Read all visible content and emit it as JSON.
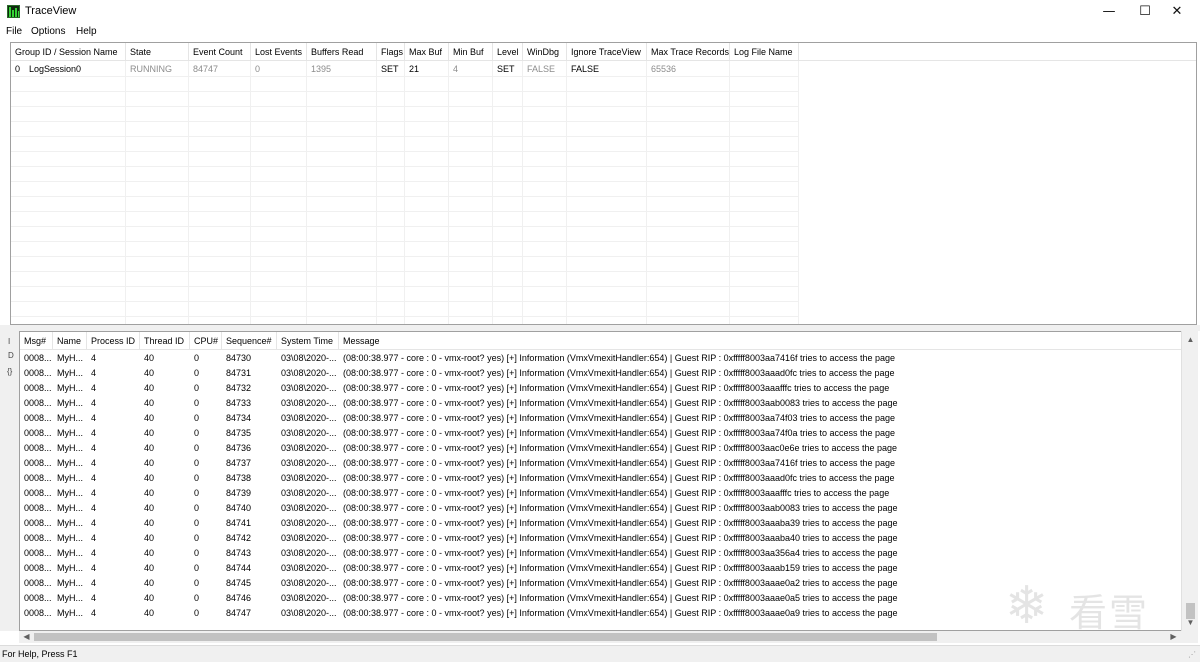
{
  "window": {
    "title": "TraceView",
    "minimize": "—",
    "maximize": "☐",
    "close": "✕"
  },
  "menu": [
    "File",
    "Options",
    "Help"
  ],
  "sessions": {
    "columns": [
      "Group ID / Session Name",
      "State",
      "Event Count",
      "Lost Events",
      "Buffers Read",
      "Flags",
      "Max Buf",
      "Min Buf",
      "Level",
      "WinDbg",
      "Ignore TraceView",
      "Max Trace Records",
      "Log File Name"
    ],
    "rows": [
      {
        "group_id": "0",
        "session_name": "LogSession0",
        "state": "RUNNING",
        "event_count": "84747",
        "lost_events": "0",
        "buffers_read": "1395",
        "flags": "SET",
        "max_buf": "21",
        "min_buf": "4",
        "level": "SET",
        "windbg": "FALSE",
        "ignore_traceview": "FALSE",
        "max_trace_records": "65536",
        "log_file_name": ""
      }
    ]
  },
  "gutter_labels": [
    "I",
    "D",
    "{}"
  ],
  "messages": {
    "columns": [
      "Msg#",
      "Name",
      "Process ID",
      "Thread ID",
      "CPU#",
      "Sequence#",
      "System Time",
      "Message"
    ],
    "rows": [
      {
        "msg": "0008...",
        "name": "MyH...",
        "pid": "4",
        "tid": "40",
        "cpu": "0",
        "seq": "84730",
        "time": "03\\08\\2020-...",
        "message": "(08:00:38.977 - core : 0 - vmx-root? yes)  [+] Information (VmxVmexitHandler:654) | Guest RIP : 0xfffff8003aa7416f tries to access the page"
      },
      {
        "msg": "0008...",
        "name": "MyH...",
        "pid": "4",
        "tid": "40",
        "cpu": "0",
        "seq": "84731",
        "time": "03\\08\\2020-...",
        "message": "(08:00:38.977 - core : 0 - vmx-root? yes)  [+] Information (VmxVmexitHandler:654) | Guest RIP : 0xfffff8003aaad0fc tries to access the page"
      },
      {
        "msg": "0008...",
        "name": "MyH...",
        "pid": "4",
        "tid": "40",
        "cpu": "0",
        "seq": "84732",
        "time": "03\\08\\2020-...",
        "message": "(08:00:38.977 - core : 0 - vmx-root? yes)  [+] Information (VmxVmexitHandler:654) | Guest RIP : 0xfffff8003aaafffc tries to access the page"
      },
      {
        "msg": "0008...",
        "name": "MyH...",
        "pid": "4",
        "tid": "40",
        "cpu": "0",
        "seq": "84733",
        "time": "03\\08\\2020-...",
        "message": "(08:00:38.977 - core : 0 - vmx-root? yes)  [+] Information (VmxVmexitHandler:654) | Guest RIP : 0xfffff8003aab0083 tries to access the page"
      },
      {
        "msg": "0008...",
        "name": "MyH...",
        "pid": "4",
        "tid": "40",
        "cpu": "0",
        "seq": "84734",
        "time": "03\\08\\2020-...",
        "message": "(08:00:38.977 - core : 0 - vmx-root? yes)  [+] Information (VmxVmexitHandler:654) | Guest RIP : 0xfffff8003aa74f03 tries to access the page"
      },
      {
        "msg": "0008...",
        "name": "MyH...",
        "pid": "4",
        "tid": "40",
        "cpu": "0",
        "seq": "84735",
        "time": "03\\08\\2020-...",
        "message": "(08:00:38.977 - core : 0 - vmx-root? yes)  [+] Information (VmxVmexitHandler:654) | Guest RIP : 0xfffff8003aa74f0a tries to access the page"
      },
      {
        "msg": "0008...",
        "name": "MyH...",
        "pid": "4",
        "tid": "40",
        "cpu": "0",
        "seq": "84736",
        "time": "03\\08\\2020-...",
        "message": "(08:00:38.977 - core : 0 - vmx-root? yes)  [+] Information (VmxVmexitHandler:654) | Guest RIP : 0xfffff8003aac0e6e tries to access the page"
      },
      {
        "msg": "0008...",
        "name": "MyH...",
        "pid": "4",
        "tid": "40",
        "cpu": "0",
        "seq": "84737",
        "time": "03\\08\\2020-...",
        "message": "(08:00:38.977 - core : 0 - vmx-root? yes)  [+] Information (VmxVmexitHandler:654) | Guest RIP : 0xfffff8003aa7416f tries to access the page"
      },
      {
        "msg": "0008...",
        "name": "MyH...",
        "pid": "4",
        "tid": "40",
        "cpu": "0",
        "seq": "84738",
        "time": "03\\08\\2020-...",
        "message": "(08:00:38.977 - core : 0 - vmx-root? yes)  [+] Information (VmxVmexitHandler:654) | Guest RIP : 0xfffff8003aaad0fc tries to access the page"
      },
      {
        "msg": "0008...",
        "name": "MyH...",
        "pid": "4",
        "tid": "40",
        "cpu": "0",
        "seq": "84739",
        "time": "03\\08\\2020-...",
        "message": "(08:00:38.977 - core : 0 - vmx-root? yes)  [+] Information (VmxVmexitHandler:654) | Guest RIP : 0xfffff8003aaafffc tries to access the page"
      },
      {
        "msg": "0008...",
        "name": "MyH...",
        "pid": "4",
        "tid": "40",
        "cpu": "0",
        "seq": "84740",
        "time": "03\\08\\2020-...",
        "message": "(08:00:38.977 - core : 0 - vmx-root? yes)  [+] Information (VmxVmexitHandler:654) | Guest RIP : 0xfffff8003aab0083 tries to access the page"
      },
      {
        "msg": "0008...",
        "name": "MyH...",
        "pid": "4",
        "tid": "40",
        "cpu": "0",
        "seq": "84741",
        "time": "03\\08\\2020-...",
        "message": "(08:00:38.977 - core : 0 - vmx-root? yes)  [+] Information (VmxVmexitHandler:654) | Guest RIP : 0xfffff8003aaaba39 tries to access the page"
      },
      {
        "msg": "0008...",
        "name": "MyH...",
        "pid": "4",
        "tid": "40",
        "cpu": "0",
        "seq": "84742",
        "time": "03\\08\\2020-...",
        "message": "(08:00:38.977 - core : 0 - vmx-root? yes)  [+] Information (VmxVmexitHandler:654) | Guest RIP : 0xfffff8003aaaba40 tries to access the page"
      },
      {
        "msg": "0008...",
        "name": "MyH...",
        "pid": "4",
        "tid": "40",
        "cpu": "0",
        "seq": "84743",
        "time": "03\\08\\2020-...",
        "message": "(08:00:38.977 - core : 0 - vmx-root? yes)  [+] Information (VmxVmexitHandler:654) | Guest RIP : 0xfffff8003aa356a4 tries to access the page"
      },
      {
        "msg": "0008...",
        "name": "MyH...",
        "pid": "4",
        "tid": "40",
        "cpu": "0",
        "seq": "84744",
        "time": "03\\08\\2020-...",
        "message": "(08:00:38.977 - core : 0 - vmx-root? yes)  [+] Information (VmxVmexitHandler:654) | Guest RIP : 0xfffff8003aaab159 tries to access the page"
      },
      {
        "msg": "0008...",
        "name": "MyH...",
        "pid": "4",
        "tid": "40",
        "cpu": "0",
        "seq": "84745",
        "time": "03\\08\\2020-...",
        "message": "(08:00:38.977 - core : 0 - vmx-root? yes)  [+] Information (VmxVmexitHandler:654) | Guest RIP : 0xfffff8003aaae0a2 tries to access the page"
      },
      {
        "msg": "0008...",
        "name": "MyH...",
        "pid": "4",
        "tid": "40",
        "cpu": "0",
        "seq": "84746",
        "time": "03\\08\\2020-...",
        "message": "(08:00:38.977 - core : 0 - vmx-root? yes)  [+] Information (VmxVmexitHandler:654) | Guest RIP : 0xfffff8003aaae0a5 tries to access the page"
      },
      {
        "msg": "0008...",
        "name": "MyH...",
        "pid": "4",
        "tid": "40",
        "cpu": "0",
        "seq": "84747",
        "time": "03\\08\\2020-...",
        "message": "(08:00:38.977 - core : 0 - vmx-root? yes)  [+] Information (VmxVmexitHandler:654) | Guest RIP : 0xfffff8003aaae0a9 tries to access the page"
      }
    ]
  },
  "status_bar": "For Help, Press F1",
  "watermark": "看雪",
  "colors": {
    "dim_text": "#8c8c8c",
    "chrome": "#f0f0f0",
    "grid": "#f0f0f0",
    "icon_green": "#36d336"
  }
}
